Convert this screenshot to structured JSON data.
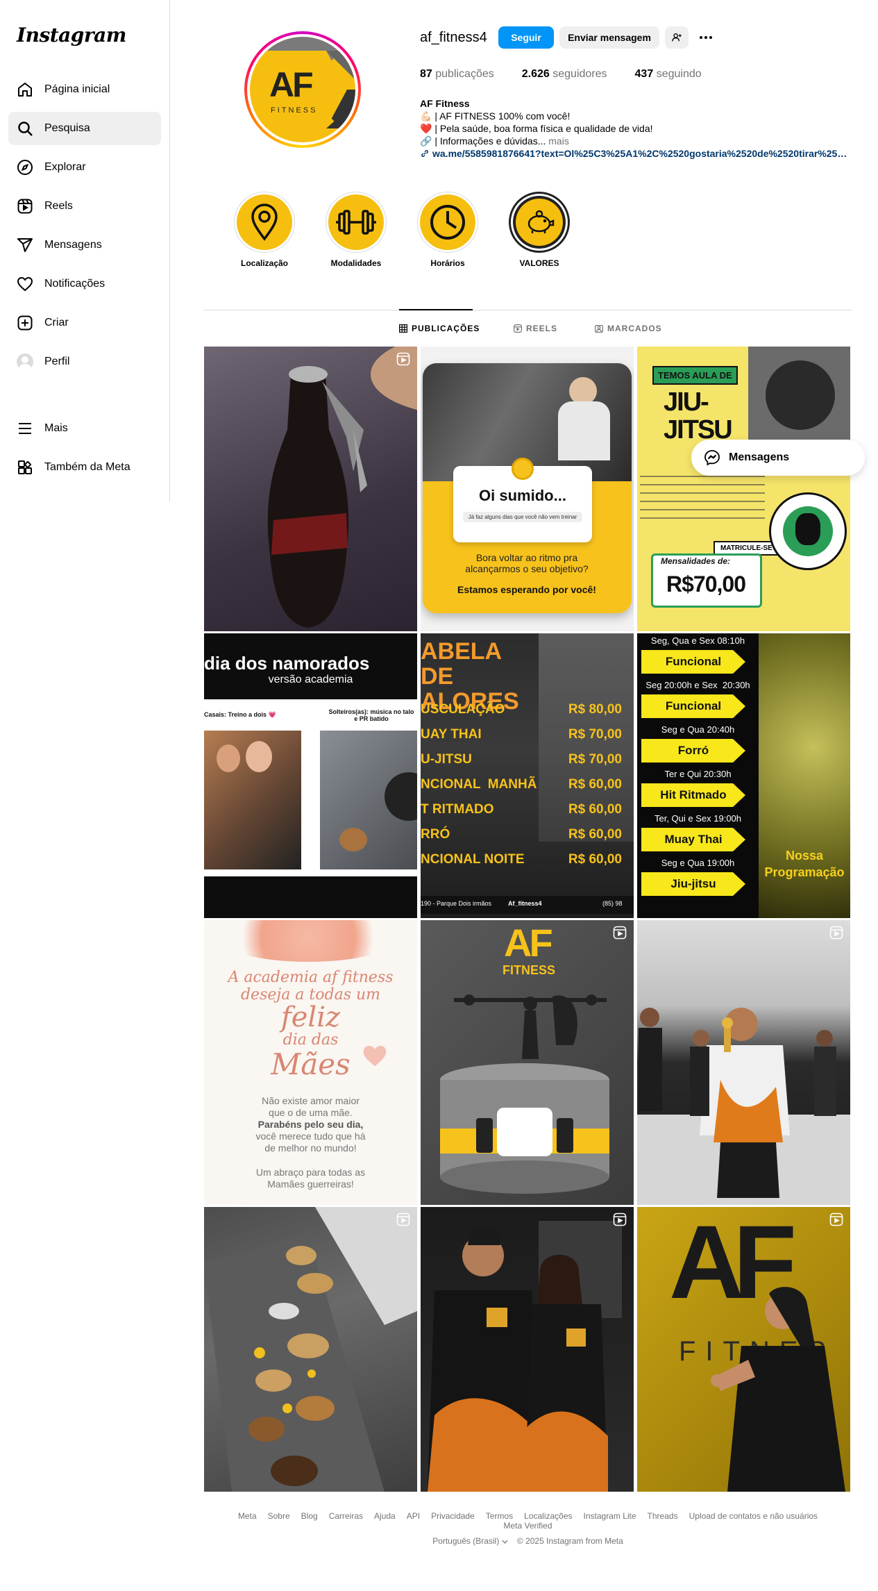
{
  "sidebar": {
    "logo": "Instagram",
    "items": [
      {
        "label": "Página inicial",
        "icon": "home-icon"
      },
      {
        "label": "Pesquisa",
        "icon": "search-icon"
      },
      {
        "label": "Explorar",
        "icon": "explore-icon"
      },
      {
        "label": "Reels",
        "icon": "reels-icon"
      },
      {
        "label": "Mensagens",
        "icon": "messages-icon"
      },
      {
        "label": "Notificações",
        "icon": "heart-icon"
      },
      {
        "label": "Criar",
        "icon": "create-icon"
      },
      {
        "label": "Perfil",
        "icon": "profile-avatar"
      }
    ],
    "more_label": "Mais",
    "meta_label": "Também da Meta"
  },
  "profile": {
    "username": "af_fitness4",
    "follow_label": "Seguir",
    "message_label": "Enviar mensagem",
    "avatar_text": "AF",
    "avatar_sub": "FITNESS",
    "stats": {
      "posts_count": "87",
      "posts_label": "publicações",
      "followers_count": "2.626",
      "followers_label": "seguidores",
      "following_count": "437",
      "following_label": "seguindo"
    },
    "bio": {
      "name": "AF Fitness",
      "line1": "💪🏻 | AF FITNESS 100% com você!",
      "line2": "❤️ | Pela saúde, boa forma física e qualidade de vida!",
      "line3": "🔗 | Informações e dúvidas...",
      "more": "mais",
      "link": "wa.me/5585981876641?text=Ol%25C3%25A1%2C%2520gostaria%2520de%2520tirar%2520u..."
    }
  },
  "highlights": [
    {
      "label": "Localização",
      "icon": "location-pin-icon"
    },
    {
      "label": "Modalidades",
      "icon": "dumbbell-icon"
    },
    {
      "label": "Horários",
      "icon": "clock-icon"
    },
    {
      "label": "VALORES",
      "icon": "piggy-bank-icon"
    }
  ],
  "tabs": [
    {
      "label": "PUBLICAÇÕES",
      "active": true
    },
    {
      "label": "REELS",
      "active": false
    },
    {
      "label": "MARCADOS",
      "active": false
    }
  ],
  "posts": {
    "p2": {
      "title": "Oi sumido...",
      "sub": "Já faz alguns dias que você não vem treinar",
      "q": "Bora voltar ao ritmo pra alcançarmos o seu objetivo?",
      "cta": "Estamos esperando por você!"
    },
    "p3": {
      "tag": "TEMOS AULA DE",
      "title": "JIU-JITSU",
      "cta": "MATRICULE-SE JÁ!",
      "price_label": "Mensalidades de:",
      "price": "R$70,00"
    },
    "p4": {
      "title": "dia dos namorados",
      "sub": "versão academia",
      "left": "Casais: Treino a dois 💗",
      "right": "Solteiros(as): música no talo e PR batido"
    },
    "p5": {
      "title": "ABELA DE ALORES",
      "rows": [
        {
          "name": "USCULAÇÃO",
          "price": "R$ 80,00"
        },
        {
          "name": "UAY THAI",
          "price": "R$ 70,00"
        },
        {
          "name": "U-JITSU",
          "price": "R$ 70,00"
        },
        {
          "name": "NCIONAL  MANHÃ",
          "price": "R$ 60,00"
        },
        {
          "name": "T RITMADO",
          "price": "R$ 60,00"
        },
        {
          "name": "RRÓ",
          "price": "R$ 60,00"
        },
        {
          "name": "NCIONAL NOITE",
          "price": "R$ 60,00"
        }
      ],
      "footer_left": "190 - Parque Dois irmãos",
      "footer_mid": "Af_fitness4",
      "footer_right": "(85) 98"
    },
    "p6": {
      "schedule": [
        {
          "time": "Seg, Qua e Sex 08:10h",
          "class": "Funcional"
        },
        {
          "time": "Seg 20:00h e Sex  20:30h",
          "class": "Funcional"
        },
        {
          "time": "Seg e Qua 20:40h",
          "class": "Forró"
        },
        {
          "time": "Ter e Qui 20:30h",
          "class": "Hit Ritmado"
        },
        {
          "time": "Ter, Qui e Sex 19:00h",
          "class": "Muay Thai"
        },
        {
          "time": "Seg e Qua 19:00h",
          "class": "Jiu-jitsu"
        }
      ],
      "right_text": "Nossa Programação"
    },
    "p7": {
      "l1": "A academia af fitness",
      "l2": "deseja a todas um",
      "l3": "feliz",
      "l4": "dia das",
      "l5": "Mães",
      "b1": "Não existe amor maior",
      "b2": "que o de uma mãe.",
      "b3": "Parabéns pelo seu dia,",
      "b4": "você merece tudo que há",
      "b5": "de melhor no mundo!",
      "c1": "Um abraço para todas as",
      "c2": "Mamães guerreiras!"
    },
    "p8": {
      "logo": "AF",
      "logo_sub": "FITNESS"
    },
    "p12": {
      "big": "AF",
      "sub": "FITNES"
    }
  },
  "floating_messages": "Mensagens",
  "footer": {
    "links": [
      "Meta",
      "Sobre",
      "Blog",
      "Carreiras",
      "Ajuda",
      "API",
      "Privacidade",
      "Termos",
      "Localizações",
      "Instagram Lite",
      "Threads",
      "Upload de contatos e não usuários",
      "Meta Verified"
    ],
    "language": "Português (Brasil)",
    "copyright": "© 2025 Instagram from Meta"
  },
  "colors": {
    "accent": "#0095f6",
    "brand_yellow": "#f6bf0f",
    "link": "#00376b"
  }
}
